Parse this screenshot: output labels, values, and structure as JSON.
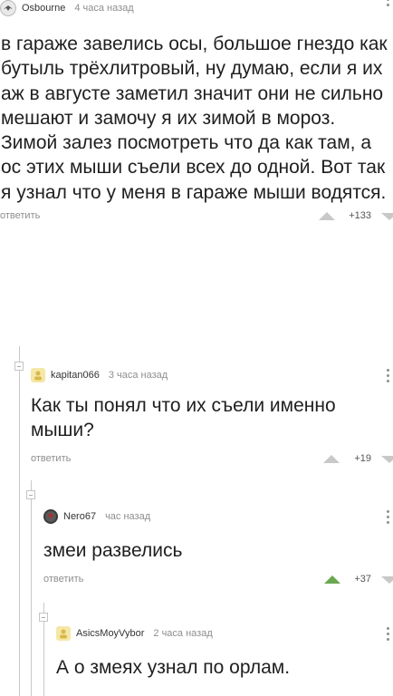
{
  "comments": [
    {
      "author": "Osbourne",
      "time": "4 часа назад",
      "text": "в гараже завелись осы, большое гнездо как бутыль трёхлитровый, ну думаю, если я их аж в августе заметил значит они не сильно мешают и замочу я их зимой в мороз. Зимой залез посмотреть что да как там, а ос этих мыши съели всех до одной. Вот так я узнал что у меня в гараже мыши водятся.",
      "reply_label": "ответить",
      "score": "+133",
      "avatar_icon": "eagle-avatar-icon"
    },
    {
      "author": "kapitan066",
      "time": "3 часа назад",
      "text": "Как ты понял что их съели именно мыши?",
      "reply_label": "ответить",
      "score": "+19",
      "avatar_icon": "default-avatar-icon"
    },
    {
      "author": "Nero67",
      "time": "час назад",
      "text": "змеи развелись",
      "reply_label": "ответить",
      "score": "+37",
      "avatar_icon": "photo-avatar-icon"
    },
    {
      "author": "AsicsMoyVybor",
      "time": "2 часа назад",
      "text": "А о змеях узнал по орлам.",
      "reply_label": "",
      "score": "",
      "avatar_icon": "default-avatar-icon"
    }
  ],
  "colors": {
    "upvote_active": "#6aa84f",
    "upvote_inactive": "#c8c8c8",
    "meta_text": "#8e8e8e",
    "thread_line": "#c9c9c9"
  }
}
